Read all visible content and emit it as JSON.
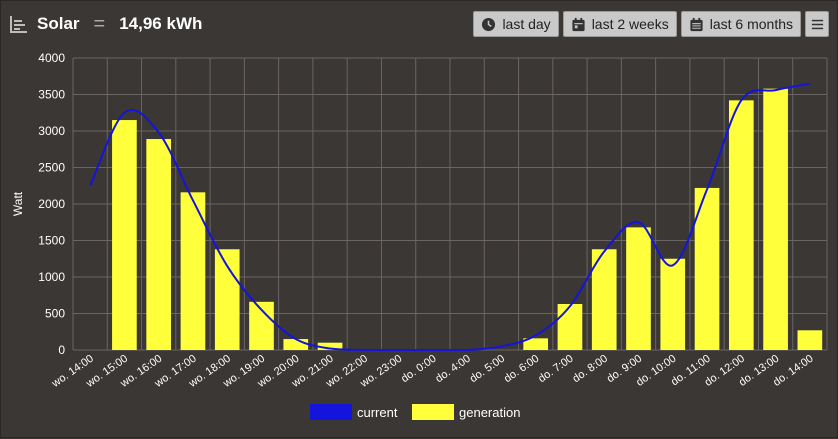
{
  "header": {
    "title": "Solar",
    "total": "14,96 kWh",
    "buttons": {
      "last_day": "last day",
      "last_2_weeks": "last 2 weeks",
      "last_6_months": "last 6 months"
    }
  },
  "colors": {
    "current": "#1414dc",
    "generation": "#ffff3c",
    "grid": "#6a6562",
    "text": "#ffffff"
  },
  "chart_data": {
    "type": "bar",
    "ylabel": "Watt",
    "ylim": [
      0,
      4000
    ],
    "yticks": [
      0,
      500,
      1000,
      1500,
      2000,
      2500,
      3000,
      3500,
      4000
    ],
    "categories": [
      "wo. 14:00",
      "wo. 15:00",
      "wo. 16:00",
      "wo. 17:00",
      "wo. 18:00",
      "wo. 19:00",
      "wo. 20:00",
      "wo. 21:00",
      "wo. 22:00",
      "wo. 23:00",
      "do. 0:00",
      "do. 4:00",
      "do. 5:00",
      "do. 6:00",
      "do. 7:00",
      "do. 8:00",
      "do. 9:00",
      "do. 10:00",
      "do. 11:00",
      "do. 12:00",
      "do. 13:00",
      "do. 14:00"
    ],
    "series": [
      {
        "name": "generation",
        "type": "bar",
        "values": [
          0,
          3150,
          2890,
          2160,
          1380,
          660,
          150,
          100,
          10,
          0,
          0,
          0,
          0,
          160,
          630,
          1380,
          1680,
          1250,
          2220,
          3420,
          3580,
          270
        ]
      },
      {
        "name": "current",
        "type": "line",
        "values": [
          2250,
          3250,
          2980,
          2050,
          1150,
          550,
          150,
          20,
          0,
          0,
          0,
          0,
          50,
          200,
          600,
          1350,
          1750,
          1160,
          2200,
          3420,
          3560,
          3650
        ]
      }
    ],
    "legend": "bottom",
    "grid": true
  }
}
